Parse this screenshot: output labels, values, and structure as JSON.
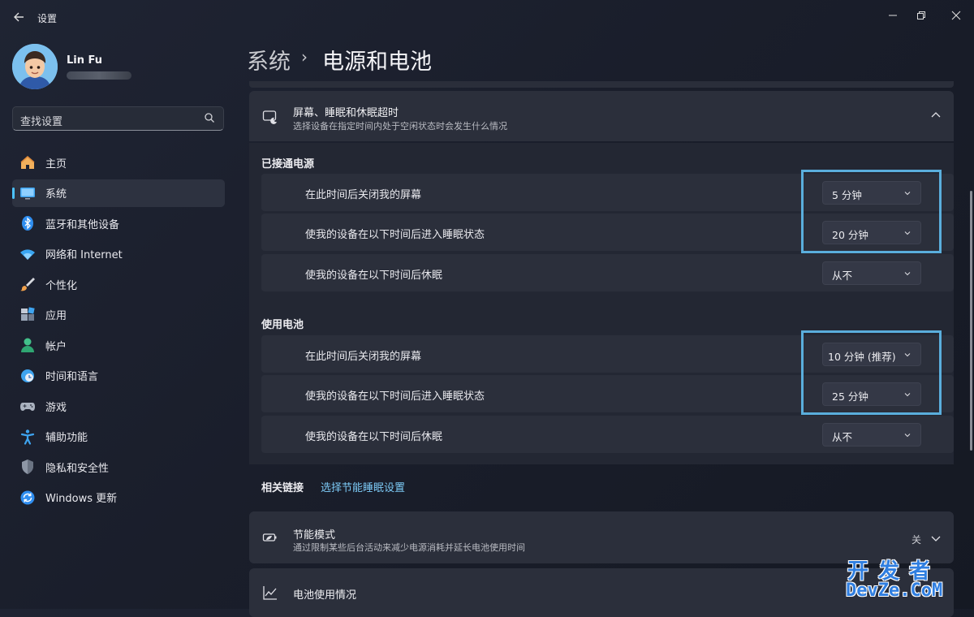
{
  "window": {
    "title": "设置",
    "controls": [
      "minimize",
      "restore",
      "close"
    ]
  },
  "user": {
    "name": "Lin Fu"
  },
  "search": {
    "placeholder": "查找设置"
  },
  "sidebar": {
    "items": [
      {
        "label": "主页",
        "icon": "home-icon",
        "active": false
      },
      {
        "label": "系统",
        "icon": "monitor-icon",
        "active": true
      },
      {
        "label": "蓝牙和其他设备",
        "icon": "bluetooth-icon",
        "active": false
      },
      {
        "label": "网络和 Internet",
        "icon": "wifi-icon",
        "active": false
      },
      {
        "label": "个性化",
        "icon": "brush-icon",
        "active": false
      },
      {
        "label": "应用",
        "icon": "apps-icon",
        "active": false
      },
      {
        "label": "帐户",
        "icon": "account-icon",
        "active": false
      },
      {
        "label": "时间和语言",
        "icon": "clock-globe-icon",
        "active": false
      },
      {
        "label": "游戏",
        "icon": "gamepad-icon",
        "active": false
      },
      {
        "label": "辅助功能",
        "icon": "accessibility-icon",
        "active": false
      },
      {
        "label": "隐私和安全性",
        "icon": "shield-icon",
        "active": false
      },
      {
        "label": "Windows 更新",
        "icon": "update-icon",
        "active": false
      }
    ]
  },
  "header": {
    "parent": "系统",
    "separator": "›",
    "current": "电源和电池"
  },
  "screen_sleep": {
    "title": "屏幕、睡眠和休眠超时",
    "subtitle": "选择设备在指定时间内处于空闲状态时会发生什么情况",
    "plugged_in": {
      "label": "已接通电源",
      "rows": [
        {
          "label": "在此时间后关闭我的屏幕",
          "value": "5 分钟"
        },
        {
          "label": "使我的设备在以下时间后进入睡眠状态",
          "value": "20 分钟"
        },
        {
          "label": "使我的设备在以下时间后休眠",
          "value": "从不"
        }
      ]
    },
    "on_battery": {
      "label": "使用电池",
      "rows": [
        {
          "label": "在此时间后关闭我的屏幕",
          "value": "10 分钟 (推荐)"
        },
        {
          "label": "使我的设备在以下时间后进入睡眠状态",
          "value": "25 分钟"
        },
        {
          "label": "使我的设备在以下时间后休眠",
          "value": "从不"
        }
      ]
    }
  },
  "related": {
    "label": "相关链接",
    "link": "选择节能睡眠设置"
  },
  "energy_saver": {
    "title": "节能模式",
    "subtitle": "通过限制某些后台活动来减少电源消耗并延长电池使用时间",
    "status": "关"
  },
  "battery_usage": {
    "title": "电池使用情况"
  },
  "watermark": {
    "top": "开发者",
    "bottom": "DevZe.CoM"
  },
  "colors": {
    "accent": "#4cc2ff",
    "highlight_box": "#5aaedc",
    "link": "#7cc9f5"
  }
}
